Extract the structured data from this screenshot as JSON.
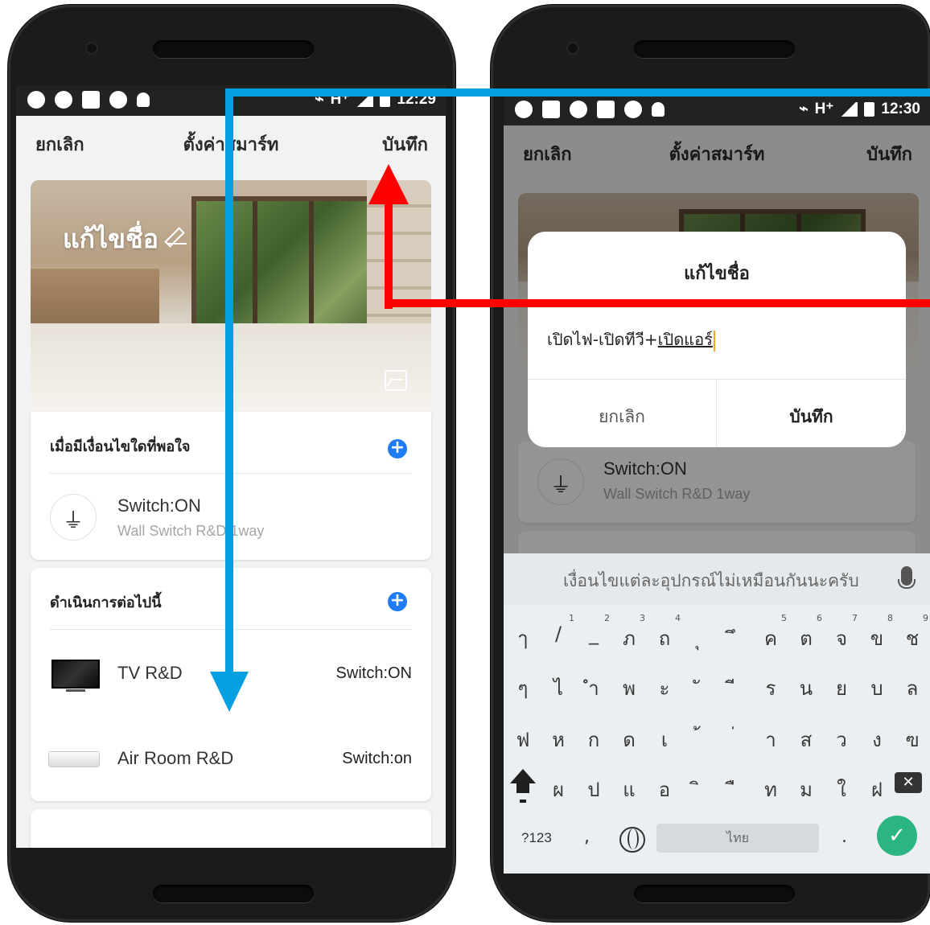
{
  "left_screen": {
    "status": {
      "time": "12:29",
      "network": "H⁺"
    },
    "topbar": {
      "cancel": "ยกเลิก",
      "title": "ตั้งค่าสมาร์ท",
      "save": "บันทึก"
    },
    "hero": {
      "rename": "แก้ไขชื่อ"
    },
    "conditions": {
      "title": "เมื่อมีเงื่อนไขใดที่พอใจ",
      "device": {
        "title": "Switch:ON",
        "subtitle": "Wall Switch R&D 1way"
      }
    },
    "actions": {
      "title": "ดำเนินการต่อไปนี้",
      "items": [
        {
          "name": "TV R&D",
          "status": "Switch:ON"
        },
        {
          "name": "Air Room R&D",
          "status": "Switch:on"
        }
      ]
    }
  },
  "right_screen": {
    "status": {
      "time": "12:30",
      "network": "H⁺"
    },
    "topbar": {
      "cancel": "ยกเลิก",
      "title": "ตั้งค่าสมาร์ท",
      "save": "บันทึก"
    },
    "behind": {
      "device_title": "Switch:ON",
      "device_subtitle": "Wall Switch R&D 1way"
    },
    "dialog": {
      "title": "แก้ไขชื่อ",
      "input_prefix": "เปิดไฟ-เปิดทีวี+",
      "input_underlined": "เปิดแอร์",
      "cancel": "ยกเลิก",
      "save": "บันทึก"
    },
    "keyboard": {
      "suggestion": "เงื่อนไขแต่ละอุปกรณ์ไม่เหมือนกันนะครับ",
      "row1": [
        "ๅ",
        "/",
        "_",
        "ภ",
        "ถ",
        "ุ",
        "ึ",
        "ค",
        "ต",
        "จ",
        "ข",
        "ช"
      ],
      "row1_sup": [
        "",
        "1",
        "2",
        "3",
        "4",
        "",
        "",
        "5",
        "6",
        "7",
        "8",
        "9"
      ],
      "row2": [
        "ๆ",
        "ไ",
        "ำ",
        "พ",
        "ะ",
        "ั",
        "ี",
        "ร",
        "น",
        "ย",
        "บ",
        "ล"
      ],
      "row3": [
        "ฟ",
        "ห",
        "ก",
        "ด",
        "เ",
        "้",
        "่",
        "า",
        "ส",
        "ว",
        "ง",
        "ฃ"
      ],
      "row4": [
        "ผ",
        "ป",
        "แ",
        "อ",
        "ิ",
        "ื",
        "ท",
        "ม",
        "ใ",
        "ฝ"
      ],
      "sym_key": "?123",
      "comma": ",",
      "space": "ไทย",
      "period": "."
    }
  },
  "colors": {
    "blue_arrow": "#06a0e2",
    "red_arrow": "#ff0000",
    "accent": "#1f7cf5",
    "enter": "#2bb582"
  }
}
